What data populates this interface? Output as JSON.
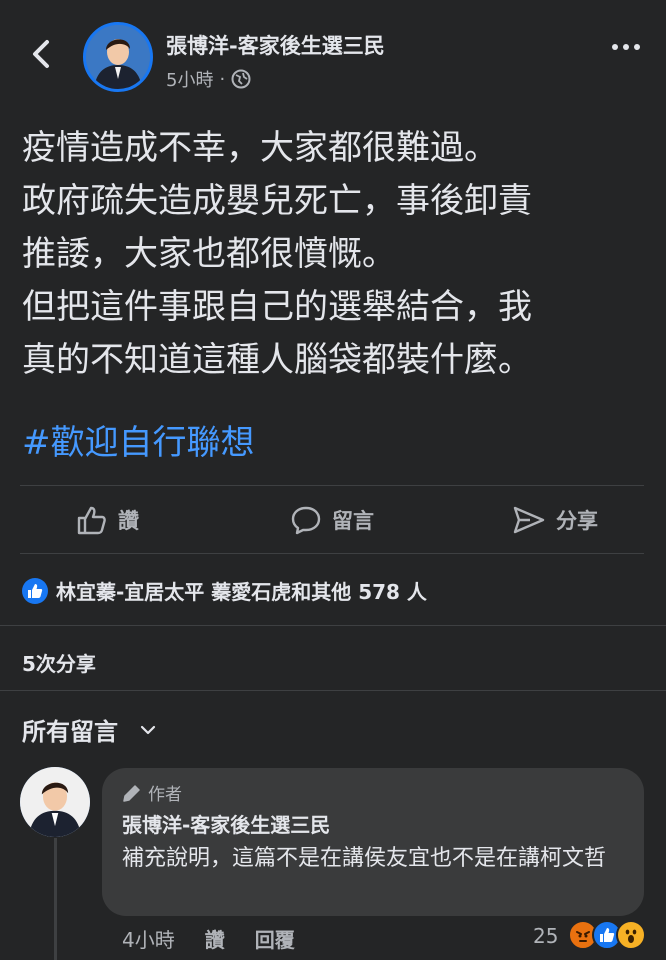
{
  "header": {
    "author_name": "張博洋-客家後生選三民",
    "time": "5小時",
    "dot": "·"
  },
  "post": {
    "lines": [
      "疫情造成不幸，大家都很難過。",
      "政府疏失造成嬰兒死亡，事後卸責",
      "推諉，大家也都很憤慨。",
      "但把這件事跟自己的選舉結合，我",
      "真的不知道這種人腦袋都裝什麼。"
    ],
    "hashtag": "#歡迎自行聯想"
  },
  "actions": {
    "like": "讚",
    "comment": "留言",
    "share": "分享"
  },
  "reactions": {
    "summary": "林宜蓁-宜居太平 蓁愛石虎和其他 578 人"
  },
  "shares": {
    "label": "5次分享"
  },
  "comments_header": {
    "label": "所有留言"
  },
  "comment": {
    "badge": "作者",
    "name": "張博洋-客家後生選三民",
    "text": "補充說明，這篇不是在講侯友宜也不是在講柯文哲",
    "time": "4小時",
    "like": "讚",
    "reply": "回覆",
    "reaction_count": "25"
  },
  "colors": {
    "background": "#242526",
    "bubble": "#3a3b3c",
    "link": "#4599ff",
    "like_blue": "#1877f2",
    "angry": "#e9710f",
    "wow": "#f7b125"
  }
}
